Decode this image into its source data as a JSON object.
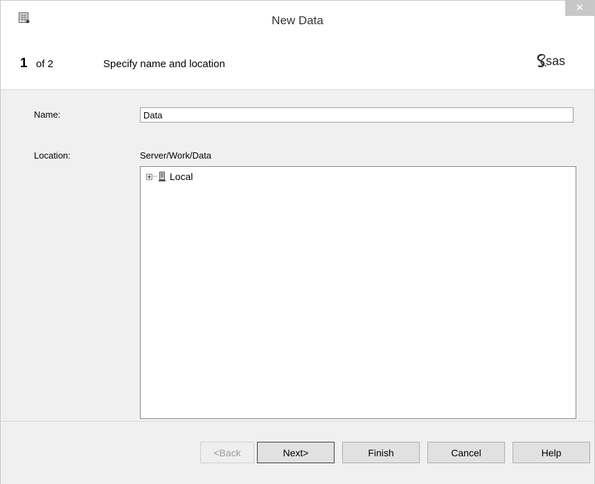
{
  "window": {
    "title": "New Data",
    "close_glyph": "✕"
  },
  "header": {
    "step_number": "1",
    "step_of": "of 2",
    "step_title": "Specify name and location",
    "logo_text": "sas"
  },
  "form": {
    "name_label": "Name:",
    "name_value": "Data",
    "location_label": "Location:",
    "location_path": "Server/Work/Data",
    "tree": [
      {
        "label": "Local",
        "icon": "server-icon",
        "expanded": false
      }
    ]
  },
  "buttons": {
    "back": "<Back",
    "next": "Next>",
    "finish": "Finish",
    "cancel": "Cancel",
    "help": "Help"
  },
  "colors": {
    "brand": "#000000",
    "footer_bg": "#f0f0f0",
    "close_bg": "#c7c7c7"
  }
}
